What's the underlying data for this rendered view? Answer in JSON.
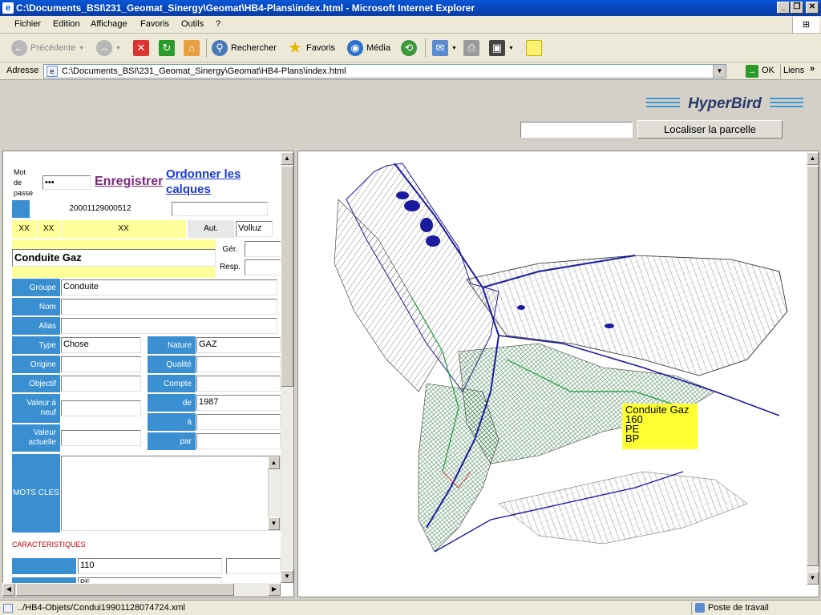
{
  "window": {
    "title": "C:\\Documents_BSI\\231_Geomat_Sinergy\\Geomat\\HB4-Plans\\index.html - Microsoft Internet Explorer"
  },
  "menu": [
    "Fichier",
    "Edition",
    "Affichage",
    "Favoris",
    "Outils",
    "?"
  ],
  "toolbar": {
    "back": "Précédente",
    "search": "Rechercher",
    "favorites": "Favoris",
    "media": "Média"
  },
  "address": {
    "label": "Adresse",
    "url": "C:\\Documents_BSI\\231_Geomat_Sinergy\\Geomat\\HB4-Plans\\index.html",
    "go": "OK",
    "links": "Liens"
  },
  "banner": {
    "logo": "HyperBird",
    "parcel_button": "Localiser la parcelle",
    "parcel_value": ""
  },
  "form": {
    "password_label": [
      "Mot",
      "de",
      "passe"
    ],
    "password_value": "•••",
    "save": "Enregistrer",
    "order_layers": "Ordonner les calques",
    "id": "20001129000512",
    "id2": "",
    "xx1": "XX",
    "xx2": "XX",
    "xx3": "XX",
    "aut_label": "Aut.",
    "aut_value": "Volluz",
    "title": "Conduite Gaz",
    "ger_label": "Gér.",
    "resp_label": "Resp.",
    "groupe_label": "Groupe",
    "groupe": "Conduite",
    "nom_label": "Nom",
    "nom": "",
    "alias_label": "Alias",
    "alias": "",
    "type_label": "Type",
    "type": "Chose",
    "nature_label": "Nature",
    "nature": "GAZ",
    "origine_label": "Origine",
    "qualite_label": "Qualité",
    "objectif_label": "Objectif",
    "compte_label": "Compte",
    "valeur_neuf_label": "Valeur à neuf",
    "de_label": "de",
    "de": "1987",
    "a_label": "à",
    "valeur_actuelle_label": "Valeur actuelle",
    "par_label": "par",
    "mots_cles_label": "MOTS CLES",
    "caracteristiques": "CARACTERISTIQUES",
    "char_value": "110",
    "char_value2": "PE"
  },
  "map": {
    "tooltip": [
      "Conduite Gaz",
      "160",
      "PE",
      "BP"
    ]
  },
  "status": {
    "text": "../HB4-Objets/Condui19901128074724.xml",
    "zone": "Poste de travail"
  }
}
